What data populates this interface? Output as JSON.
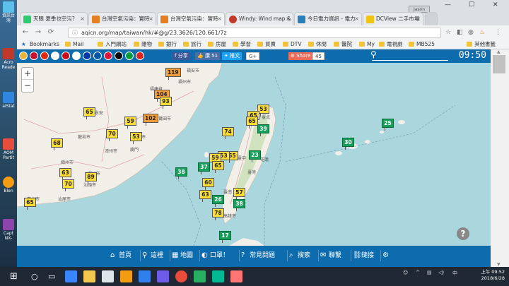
{
  "desktop": {
    "icons": [
      {
        "label": "資訊台灣",
        "color": "#5bc0eb"
      },
      {
        "label": "Acro Reade",
        "color": "#c0392b"
      },
      {
        "label": "aiStat",
        "color": "#2e86de"
      },
      {
        "label": "AOM Partit",
        "color": "#e74c3c"
      },
      {
        "label": "Blen",
        "color": "#f39c12"
      },
      {
        "label": "Capt NX-",
        "color": "#8e44ad"
      }
    ]
  },
  "browser": {
    "tabs": [
      {
        "title": "天眼 夏季也空污？",
        "favicon_color": "#2ecc71"
      },
      {
        "title": "台灣空氣污染：實時",
        "favicon_color": "#e67e22"
      },
      {
        "title": "台灣空氣污染：實時",
        "favicon_color": "#e67e22"
      },
      {
        "title": "Windy: Wind map &",
        "favicon_color": "#c0392b"
      },
      {
        "title": "今日電力資訊 - 電力",
        "favicon_color": "#2980b9"
      },
      {
        "title": "DCView 二手市場",
        "favicon_color": "#f1c40f"
      }
    ],
    "profile": "Jason",
    "address": "aqicn.org/map/taiwan/hk/#@g/23.3626/120.661/7z",
    "bookmarks": [
      "Bookmarks",
      "Mail",
      "入門網站",
      "雜物",
      "銀行",
      "旅行",
      "房屋",
      "學習",
      "買賣",
      "DTV",
      "休閒",
      "醫院",
      "My",
      "電視劇",
      "MB525",
      "其他書籤"
    ]
  },
  "site": {
    "flags": [
      "#e8b33d",
      "#c8102e",
      "#bc002d",
      "#c60b1e",
      "#0055a4",
      "#e11d2a",
      "#ffffff",
      "#d52b1e",
      "#000000",
      "#009c3b",
      "#da251d"
    ],
    "share_buttons": [
      {
        "label": "分享",
        "color": "#3b5998"
      },
      {
        "label": "讚 51",
        "color": "#4a6ea9"
      },
      {
        "label": "推文",
        "color": "#1da1f2"
      },
      {
        "label": "G+",
        "color": "#dd4b39"
      },
      {
        "label": "Share",
        "color": "#ee6b5a"
      },
      {
        "label": "45",
        "color": "#ffffff"
      }
    ],
    "clock": "09:50",
    "nav": [
      {
        "label": "首頁",
        "icon": "home-icon",
        "glyph": "⌂"
      },
      {
        "label": "這裡",
        "icon": "location-icon",
        "glyph": "⚲"
      },
      {
        "label": "地圖",
        "icon": "map-icon",
        "glyph": "▦"
      },
      {
        "label": "口罩！",
        "icon": "mask-icon",
        "glyph": "◐"
      },
      {
        "label": "常見問題",
        "icon": "faq-icon",
        "glyph": "?"
      },
      {
        "label": "搜索",
        "icon": "search-icon",
        "glyph": "⌕"
      },
      {
        "label": "聯繫",
        "icon": "contact-icon",
        "glyph": "✉"
      },
      {
        "label": "鏈接",
        "icon": "link-icon",
        "glyph": "⛓"
      },
      {
        "label": "",
        "icon": "settings-icon",
        "glyph": "⚙"
      }
    ]
  },
  "map": {
    "cities": [
      "福建省",
      "福州市",
      "莆田市",
      "泉州市",
      "廈門",
      "漳州市",
      "龍岩市",
      "梅州市",
      "汕頭市",
      "潮州市",
      "臺北",
      "臺中",
      "臺南",
      "高雄市",
      "花蓮",
      "福安市",
      "永安",
      "惠州市",
      "汕尾市",
      "臺灣"
    ],
    "stations": [
      {
        "value": 119,
        "level": "o"
      },
      {
        "value": 104,
        "level": "o"
      },
      {
        "value": 93,
        "level": "y"
      },
      {
        "value": 65,
        "level": "y"
      },
      {
        "value": 102,
        "level": "o"
      },
      {
        "value": 59,
        "level": "y"
      },
      {
        "value": 70,
        "level": "y"
      },
      {
        "value": 53,
        "level": "y"
      },
      {
        "value": 68,
        "level": "y"
      },
      {
        "value": 63,
        "level": "y"
      },
      {
        "value": 89,
        "level": "y"
      },
      {
        "value": 70,
        "level": "y"
      },
      {
        "value": 65,
        "level": "y"
      },
      {
        "value": 53,
        "level": "y"
      },
      {
        "value": 65,
        "level": "y"
      },
      {
        "value": 74,
        "level": "y"
      },
      {
        "value": 39,
        "level": "g"
      },
      {
        "value": 55,
        "level": "y"
      },
      {
        "value": 53,
        "level": "y"
      },
      {
        "value": 59,
        "level": "y"
      },
      {
        "value": 65,
        "level": "y"
      },
      {
        "value": 37,
        "level": "g"
      },
      {
        "value": 38,
        "level": "g"
      },
      {
        "value": 60,
        "level": "y"
      },
      {
        "value": 23,
        "level": "g"
      },
      {
        "value": 63,
        "level": "y"
      },
      {
        "value": 57,
        "level": "y"
      },
      {
        "value": 26,
        "level": "g"
      },
      {
        "value": 38,
        "level": "g"
      },
      {
        "value": 78,
        "level": "y"
      },
      {
        "value": 17,
        "level": "g"
      },
      {
        "value": 30,
        "level": "g"
      },
      {
        "value": 25,
        "level": "g"
      },
      {
        "value": 65,
        "level": "y"
      }
    ]
  },
  "taskbar": {
    "time": "上午 09:52",
    "date": "2018/6/28",
    "ime": "中",
    "app_colors": [
      "#ffffff",
      "#3a86ff",
      "#f2c94c",
      "#2d9cdb",
      "#f39c12",
      "#2f80ed",
      "#dfe6e9",
      "#e74c3c",
      "#27ae60",
      "#ff7675",
      "#6c5ce7",
      "#00b894"
    ]
  }
}
